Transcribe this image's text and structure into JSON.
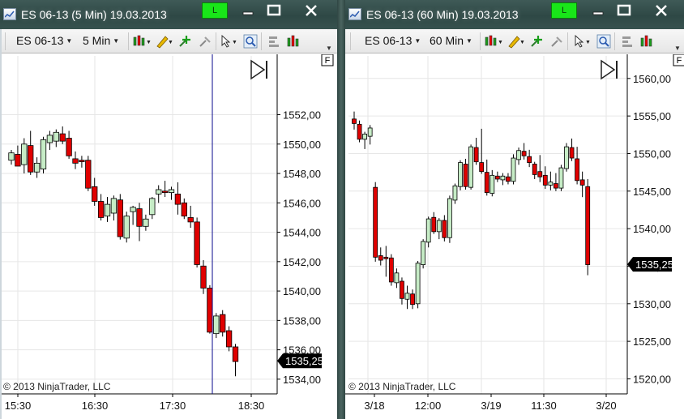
{
  "colors": {
    "up": "#c6ecc6",
    "down": "#e00000",
    "candle_outline": "#000000",
    "grid": "#e6e6e6",
    "cursor_line": "#0a0a8c",
    "price_marker_bg": "#000000",
    "price_marker_text": "#ffffff",
    "link_button": "#19e619"
  },
  "windows": [
    {
      "id": "left",
      "title": "ES 06-13 (5 Min)  19.03.2013",
      "link_label": "L",
      "toolbar": {
        "instrument": "ES 06-13",
        "interval": "5 Min"
      },
      "fixed_label": "F",
      "copyright": "© 2013 NinjaTrader, LLC",
      "current_price": "1535,25",
      "y_axis": {
        "ticks": [
          "1552,00",
          "1550,00",
          "1548,00",
          "1546,00",
          "1544,00",
          "1542,00",
          "1540,00",
          "1538,00",
          "1536,00",
          "1534,00"
        ]
      },
      "x_axis": {
        "ticks": [
          "15:30",
          "16:30",
          "17:30",
          "18:30"
        ]
      },
      "chart_data": {
        "type": "candlestick",
        "ylim": [
          1533,
          1556
        ],
        "y_ticks": [
          1552,
          1550,
          1548,
          1546,
          1544,
          1542,
          1540,
          1538,
          1536,
          1534
        ],
        "x_ticks": [
          "15:30",
          "16:30",
          "17:30",
          "18:30"
        ],
        "current_price": 1535.25,
        "cursor_after_candle": 36,
        "grid": true,
        "candles": [
          {
            "o": 1548.9,
            "h": 1549.6,
            "l": 1548.6,
            "c": 1549.4
          },
          {
            "o": 1549.3,
            "h": 1549.9,
            "l": 1548.8,
            "c": 1548.5
          },
          {
            "o": 1548.6,
            "h": 1550.4,
            "l": 1548.0,
            "c": 1550.0
          },
          {
            "o": 1549.9,
            "h": 1550.9,
            "l": 1547.9,
            "c": 1548.1
          },
          {
            "o": 1548.1,
            "h": 1549.1,
            "l": 1547.7,
            "c": 1548.7
          },
          {
            "o": 1548.3,
            "h": 1550.5,
            "l": 1548.0,
            "c": 1550.3
          },
          {
            "o": 1550.1,
            "h": 1550.9,
            "l": 1549.6,
            "c": 1550.6
          },
          {
            "o": 1550.2,
            "h": 1551.0,
            "l": 1549.8,
            "c": 1550.8
          },
          {
            "o": 1550.7,
            "h": 1551.2,
            "l": 1550.0,
            "c": 1550.2
          },
          {
            "o": 1550.4,
            "h": 1550.9,
            "l": 1549.0,
            "c": 1549.2
          },
          {
            "o": 1549.0,
            "h": 1549.5,
            "l": 1548.3,
            "c": 1548.7
          },
          {
            "o": 1548.9,
            "h": 1549.2,
            "l": 1548.4,
            "c": 1548.8
          },
          {
            "o": 1548.9,
            "h": 1549.2,
            "l": 1546.8,
            "c": 1547.0
          },
          {
            "o": 1547.1,
            "h": 1547.7,
            "l": 1545.8,
            "c": 1546.1
          },
          {
            "o": 1546.1,
            "h": 1546.6,
            "l": 1544.8,
            "c": 1545.0
          },
          {
            "o": 1545.1,
            "h": 1546.4,
            "l": 1544.7,
            "c": 1545.9
          },
          {
            "o": 1545.3,
            "h": 1546.5,
            "l": 1544.8,
            "c": 1546.3
          },
          {
            "o": 1546.2,
            "h": 1546.6,
            "l": 1543.5,
            "c": 1543.7
          },
          {
            "o": 1543.6,
            "h": 1545.4,
            "l": 1543.3,
            "c": 1545.1
          },
          {
            "o": 1545.4,
            "h": 1545.8,
            "l": 1544.5,
            "c": 1545.7
          },
          {
            "o": 1545.6,
            "h": 1546.0,
            "l": 1543.4,
            "c": 1544.4
          },
          {
            "o": 1544.4,
            "h": 1545.2,
            "l": 1544.1,
            "c": 1544.9
          },
          {
            "o": 1545.2,
            "h": 1546.4,
            "l": 1544.9,
            "c": 1546.3
          },
          {
            "o": 1546.6,
            "h": 1547.2,
            "l": 1546.0,
            "c": 1546.9
          },
          {
            "o": 1546.8,
            "h": 1547.5,
            "l": 1546.4,
            "c": 1546.7
          },
          {
            "o": 1546.7,
            "h": 1547.1,
            "l": 1546.2,
            "c": 1546.9
          },
          {
            "o": 1546.6,
            "h": 1547.4,
            "l": 1545.2,
            "c": 1545.9
          },
          {
            "o": 1546.0,
            "h": 1546.3,
            "l": 1544.9,
            "c": 1545.1
          },
          {
            "o": 1545.0,
            "h": 1545.8,
            "l": 1544.3,
            "c": 1544.7
          },
          {
            "o": 1544.7,
            "h": 1545.0,
            "l": 1541.6,
            "c": 1541.8
          },
          {
            "o": 1541.7,
            "h": 1542.1,
            "l": 1539.8,
            "c": 1540.2
          },
          {
            "o": 1540.2,
            "h": 1540.4,
            "l": 1537.1,
            "c": 1537.2
          },
          {
            "o": 1537.1,
            "h": 1538.5,
            "l": 1536.8,
            "c": 1538.3
          },
          {
            "o": 1538.4,
            "h": 1538.7,
            "l": 1536.9,
            "c": 1537.2
          },
          {
            "o": 1537.3,
            "h": 1537.6,
            "l": 1535.9,
            "c": 1536.2
          },
          {
            "o": 1536.2,
            "h": 1536.4,
            "l": 1534.2,
            "c": 1535.2
          }
        ]
      }
    },
    {
      "id": "right",
      "title": "ES 06-13 (60 Min)  19.03.2013",
      "link_label": "L",
      "toolbar": {
        "instrument": "ES 06-13",
        "interval": "60 Min"
      },
      "fixed_label": "F",
      "copyright": "© 2013 NinjaTrader, LLC",
      "current_price": "1535,25",
      "y_axis": {
        "ticks": [
          "1560,00",
          "1555,00",
          "1550,00",
          "1545,00",
          "1540,00",
          "1535,00",
          "1530,00",
          "1525,00",
          "1520,00"
        ]
      },
      "x_axis": {
        "ticks": [
          "3/18",
          "12:00",
          "3/19",
          "11:30",
          "3/20"
        ]
      },
      "chart_data": {
        "type": "candlestick",
        "ylim": [
          1518,
          1563
        ],
        "y_ticks": [
          1560,
          1555,
          1550,
          1545,
          1540,
          1535,
          1530,
          1525,
          1520
        ],
        "x_ticks": [
          "3/18",
          "12:00",
          "3/19",
          "11:30",
          "3/20"
        ],
        "current_price": 1535.25,
        "grid": true,
        "candles": [
          {
            "o": 1554.6,
            "h": 1555.6,
            "l": 1553.2,
            "c": 1554.0
          },
          {
            "o": 1553.9,
            "h": 1554.4,
            "l": 1551.5,
            "c": 1551.9
          },
          {
            "o": 1551.9,
            "h": 1552.9,
            "l": 1550.6,
            "c": 1552.6
          },
          {
            "o": 1552.3,
            "h": 1553.8,
            "l": 1551.2,
            "c": 1553.4
          },
          {
            "o": 1545.5,
            "h": 1546.2,
            "l": 1535.6,
            "c": 1536.2
          },
          {
            "o": 1536.4,
            "h": 1537.5,
            "l": 1535.1,
            "c": 1535.8
          },
          {
            "o": 1536.2,
            "h": 1537.7,
            "l": 1533.6,
            "c": 1536.0
          },
          {
            "o": 1536.1,
            "h": 1536.6,
            "l": 1532.4,
            "c": 1532.9
          },
          {
            "o": 1532.8,
            "h": 1534.7,
            "l": 1532.1,
            "c": 1534.1
          },
          {
            "o": 1533.0,
            "h": 1533.5,
            "l": 1529.9,
            "c": 1530.7
          },
          {
            "o": 1530.6,
            "h": 1532.4,
            "l": 1529.3,
            "c": 1531.4
          },
          {
            "o": 1531.3,
            "h": 1531.9,
            "l": 1529.3,
            "c": 1529.9
          },
          {
            "o": 1530.0,
            "h": 1535.7,
            "l": 1529.4,
            "c": 1535.4
          },
          {
            "o": 1535.2,
            "h": 1538.6,
            "l": 1534.7,
            "c": 1538.3
          },
          {
            "o": 1538.2,
            "h": 1541.6,
            "l": 1537.5,
            "c": 1541.3
          },
          {
            "o": 1541.5,
            "h": 1542.2,
            "l": 1539.3,
            "c": 1539.6
          },
          {
            "o": 1539.6,
            "h": 1541.4,
            "l": 1538.6,
            "c": 1541.1
          },
          {
            "o": 1541.1,
            "h": 1541.8,
            "l": 1538.3,
            "c": 1538.8
          },
          {
            "o": 1538.8,
            "h": 1544.4,
            "l": 1538.1,
            "c": 1544.0
          },
          {
            "o": 1543.8,
            "h": 1546.0,
            "l": 1543.3,
            "c": 1545.7
          },
          {
            "o": 1545.6,
            "h": 1549.1,
            "l": 1545.1,
            "c": 1548.8
          },
          {
            "o": 1548.6,
            "h": 1549.3,
            "l": 1545.2,
            "c": 1545.6
          },
          {
            "o": 1545.5,
            "h": 1551.2,
            "l": 1545.2,
            "c": 1550.9
          },
          {
            "o": 1550.8,
            "h": 1552.1,
            "l": 1548.5,
            "c": 1548.9
          },
          {
            "o": 1548.8,
            "h": 1553.3,
            "l": 1547.3,
            "c": 1547.6
          },
          {
            "o": 1547.5,
            "h": 1549.2,
            "l": 1544.4,
            "c": 1544.8
          },
          {
            "o": 1544.7,
            "h": 1547.8,
            "l": 1544.3,
            "c": 1547.1
          },
          {
            "o": 1547.0,
            "h": 1547.6,
            "l": 1546.2,
            "c": 1546.6
          },
          {
            "o": 1546.5,
            "h": 1547.4,
            "l": 1545.8,
            "c": 1547.0
          },
          {
            "o": 1546.9,
            "h": 1547.4,
            "l": 1545.9,
            "c": 1546.3
          },
          {
            "o": 1546.3,
            "h": 1549.9,
            "l": 1545.9,
            "c": 1549.4
          },
          {
            "o": 1549.2,
            "h": 1550.8,
            "l": 1548.5,
            "c": 1550.4
          },
          {
            "o": 1550.3,
            "h": 1551.4,
            "l": 1549.2,
            "c": 1549.7
          },
          {
            "o": 1549.6,
            "h": 1550.5,
            "l": 1548.2,
            "c": 1548.8
          },
          {
            "o": 1548.6,
            "h": 1548.9,
            "l": 1546.6,
            "c": 1547.2
          },
          {
            "o": 1547.6,
            "h": 1549.8,
            "l": 1546.2,
            "c": 1546.9
          },
          {
            "o": 1547.1,
            "h": 1548.3,
            "l": 1545.3,
            "c": 1545.8
          },
          {
            "o": 1545.8,
            "h": 1547.6,
            "l": 1545.1,
            "c": 1546.2
          },
          {
            "o": 1546.0,
            "h": 1547.4,
            "l": 1545.0,
            "c": 1545.4
          },
          {
            "o": 1545.4,
            "h": 1548.5,
            "l": 1545.0,
            "c": 1548.1
          },
          {
            "o": 1548.0,
            "h": 1551.4,
            "l": 1547.6,
            "c": 1550.9
          },
          {
            "o": 1550.8,
            "h": 1552.0,
            "l": 1549.0,
            "c": 1549.4
          },
          {
            "o": 1549.3,
            "h": 1550.9,
            "l": 1545.9,
            "c": 1546.4
          },
          {
            "o": 1546.5,
            "h": 1547.6,
            "l": 1544.2,
            "c": 1545.8
          },
          {
            "o": 1545.6,
            "h": 1546.6,
            "l": 1533.8,
            "c": 1535.2
          }
        ]
      }
    }
  ]
}
